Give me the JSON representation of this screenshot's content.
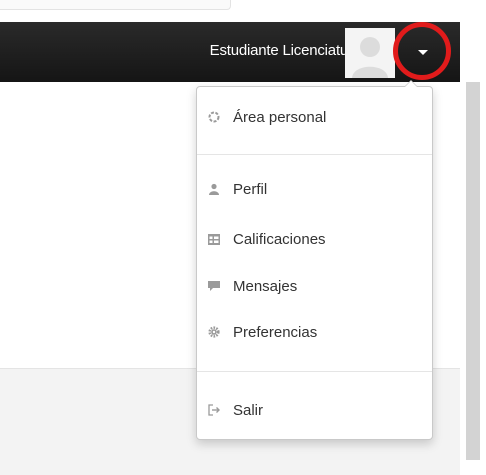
{
  "header": {
    "user_name": "Estudiante Licenciatura"
  },
  "user_menu": {
    "items": [
      {
        "label": "Área personal",
        "icon": "dashboard-icon"
      },
      {
        "label": "Perfil",
        "icon": "user-icon"
      },
      {
        "label": "Calificaciones",
        "icon": "table-icon"
      },
      {
        "label": "Mensajes",
        "icon": "comment-icon"
      },
      {
        "label": "Preferencias",
        "icon": "gear-icon"
      },
      {
        "label": "Salir",
        "icon": "sign-out-icon"
      }
    ]
  },
  "colors": {
    "navbar": "#1c1c1c",
    "highlight_ring": "#e11b1b",
    "menu_text": "#333333",
    "icon_gray": "#9a9a9a"
  }
}
